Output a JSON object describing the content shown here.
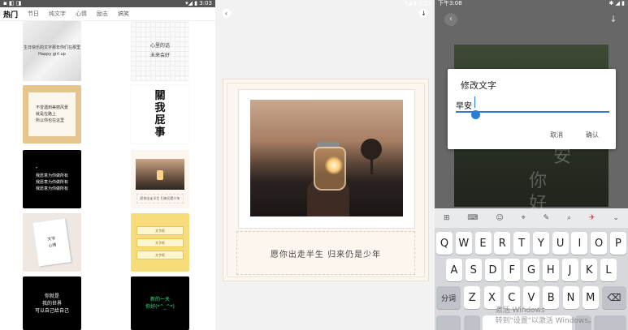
{
  "panel1": {
    "status_left": "▪ ◧ ◨",
    "status_right": "▾◢ ▮ 3:03",
    "tabs": [
      "热门",
      "节日",
      "纯文字",
      "心情",
      "励志",
      "搞笑"
    ],
    "cards": {
      "crumple": "生日快乐的文字那年你们在那里\nHappy girl up",
      "grid": "心里的话\n未来会好",
      "beige": "不曾遇到美丽风景\n就是在路上\n所以你也在这里",
      "vertical": "關\n我\n屁\n事",
      "black1": "“\n我愿意为你做所有\n我愿意为你做所有\n我愿意为你做所有",
      "polaroid_caption": "愿你出走半生 归来仍是少年",
      "note": "文字\n心情",
      "yellow": [
        "文字框",
        "文字框",
        "文字框"
      ],
      "black2": "你就是\n我的世界\n可以自己给自己",
      "black3": "新的一天\n你好(*^_^*)"
    }
  },
  "panel2": {
    "status_right": "▾◢ ▮ 3:03",
    "back_icon": "‹",
    "download_icon": "↓",
    "caption": "愿你出走半生 归来仍是少年"
  },
  "panel3": {
    "status_left": "下午3:08",
    "status_right": "✱ ◢ ▮",
    "bg_chars": [
      "安",
      "你",
      "好"
    ],
    "dialog": {
      "title": "修改文字",
      "value": "早安",
      "cancel": "取消",
      "confirm": "确认"
    },
    "toolbar": [
      "⊞",
      "⌨",
      "☺",
      "⌖",
      "✎",
      "⌕",
      "✈",
      "⌄"
    ],
    "row1": [
      "Q",
      "W",
      "E",
      "R",
      "T",
      "Y",
      "U",
      "I",
      "O",
      "P"
    ],
    "row2": [
      "A",
      "S",
      "D",
      "F",
      "G",
      "H",
      "J",
      "K",
      "L"
    ],
    "row3_left": "分词",
    "row3": [
      "Z",
      "X",
      "C",
      "V",
      "B",
      "N",
      "M"
    ],
    "row3_right": "⌫",
    "watermark": "激活 Windows\n转到\"设置\"以激活 Windows。"
  }
}
